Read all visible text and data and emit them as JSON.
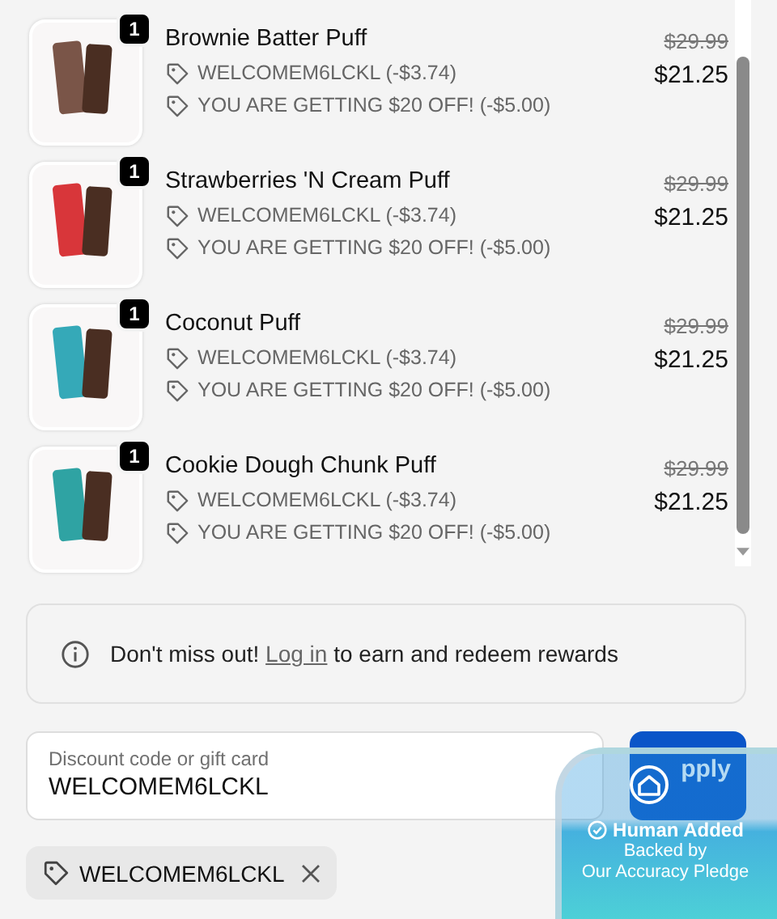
{
  "items": [
    {
      "name": "Brownie Batter Puff",
      "quantity": "1",
      "color": "#7a5548",
      "discounts": [
        "WELCOMEM6LCKL (-$3.74)",
        "YOU ARE GETTING $20 OFF! (-$5.00)"
      ],
      "original_price": "$29.99",
      "price": "$21.25"
    },
    {
      "name": "Strawberries 'N Cream Puff",
      "quantity": "1",
      "color": "#d8363a",
      "discounts": [
        "WELCOMEM6LCKL (-$3.74)",
        "YOU ARE GETTING $20 OFF! (-$5.00)"
      ],
      "original_price": "$29.99",
      "price": "$21.25"
    },
    {
      "name": "Coconut Puff",
      "quantity": "1",
      "color": "#35a9b8",
      "discounts": [
        "WELCOMEM6LCKL (-$3.74)",
        "YOU ARE GETTING $20 OFF! (-$5.00)"
      ],
      "original_price": "$29.99",
      "price": "$21.25"
    },
    {
      "name": "Cookie Dough Chunk Puff",
      "quantity": "1",
      "color": "#2fa3a3",
      "discounts": [
        "WELCOMEM6LCKL (-$3.74)",
        "YOU ARE GETTING $20 OFF! (-$5.00)"
      ],
      "original_price": "$29.99",
      "price": "$21.25"
    }
  ],
  "rewards": {
    "before": "Don't miss out!",
    "link": "Log in",
    "after": "to earn and redeem rewards"
  },
  "discount_field": {
    "placeholder": "Discount code or gift card",
    "value": "WELCOMEM6LCKL"
  },
  "apply_button": "pply",
  "applied_code": "WELCOMEM6LCKL",
  "trust_badge": {
    "title": "Human Added",
    "line_1": "Backed by",
    "line_2": "Our Accuracy Pledge"
  }
}
